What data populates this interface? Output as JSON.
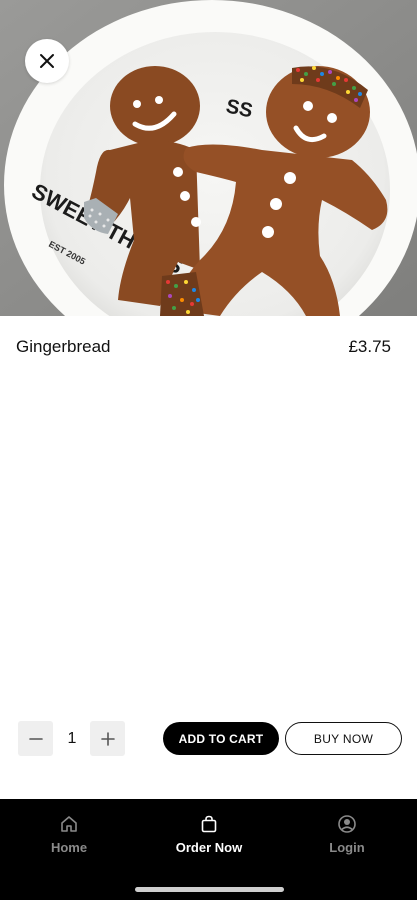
{
  "product": {
    "name": "Gingerbread",
    "price": "£3.75",
    "image_alt": "Two gingerbread people on a Sweet Things plate",
    "plate_text_main": "SWEET THINGS",
    "plate_text_sub": "EST 2005"
  },
  "actions": {
    "quantity": "1",
    "add_to_cart": "ADD TO CART",
    "buy_now": "BUY NOW"
  },
  "nav": {
    "items": [
      {
        "label": "Home",
        "icon": "home-icon",
        "active": false
      },
      {
        "label": "Order Now",
        "icon": "bag-icon",
        "active": true
      },
      {
        "label": "Login",
        "icon": "user-icon",
        "active": false
      }
    ]
  },
  "colors": {
    "nav_background": "#000000",
    "active_nav": "#ffffff",
    "inactive_nav": "#8a8a8a",
    "primary_button": "#000000",
    "stepper_background": "#efefef"
  }
}
